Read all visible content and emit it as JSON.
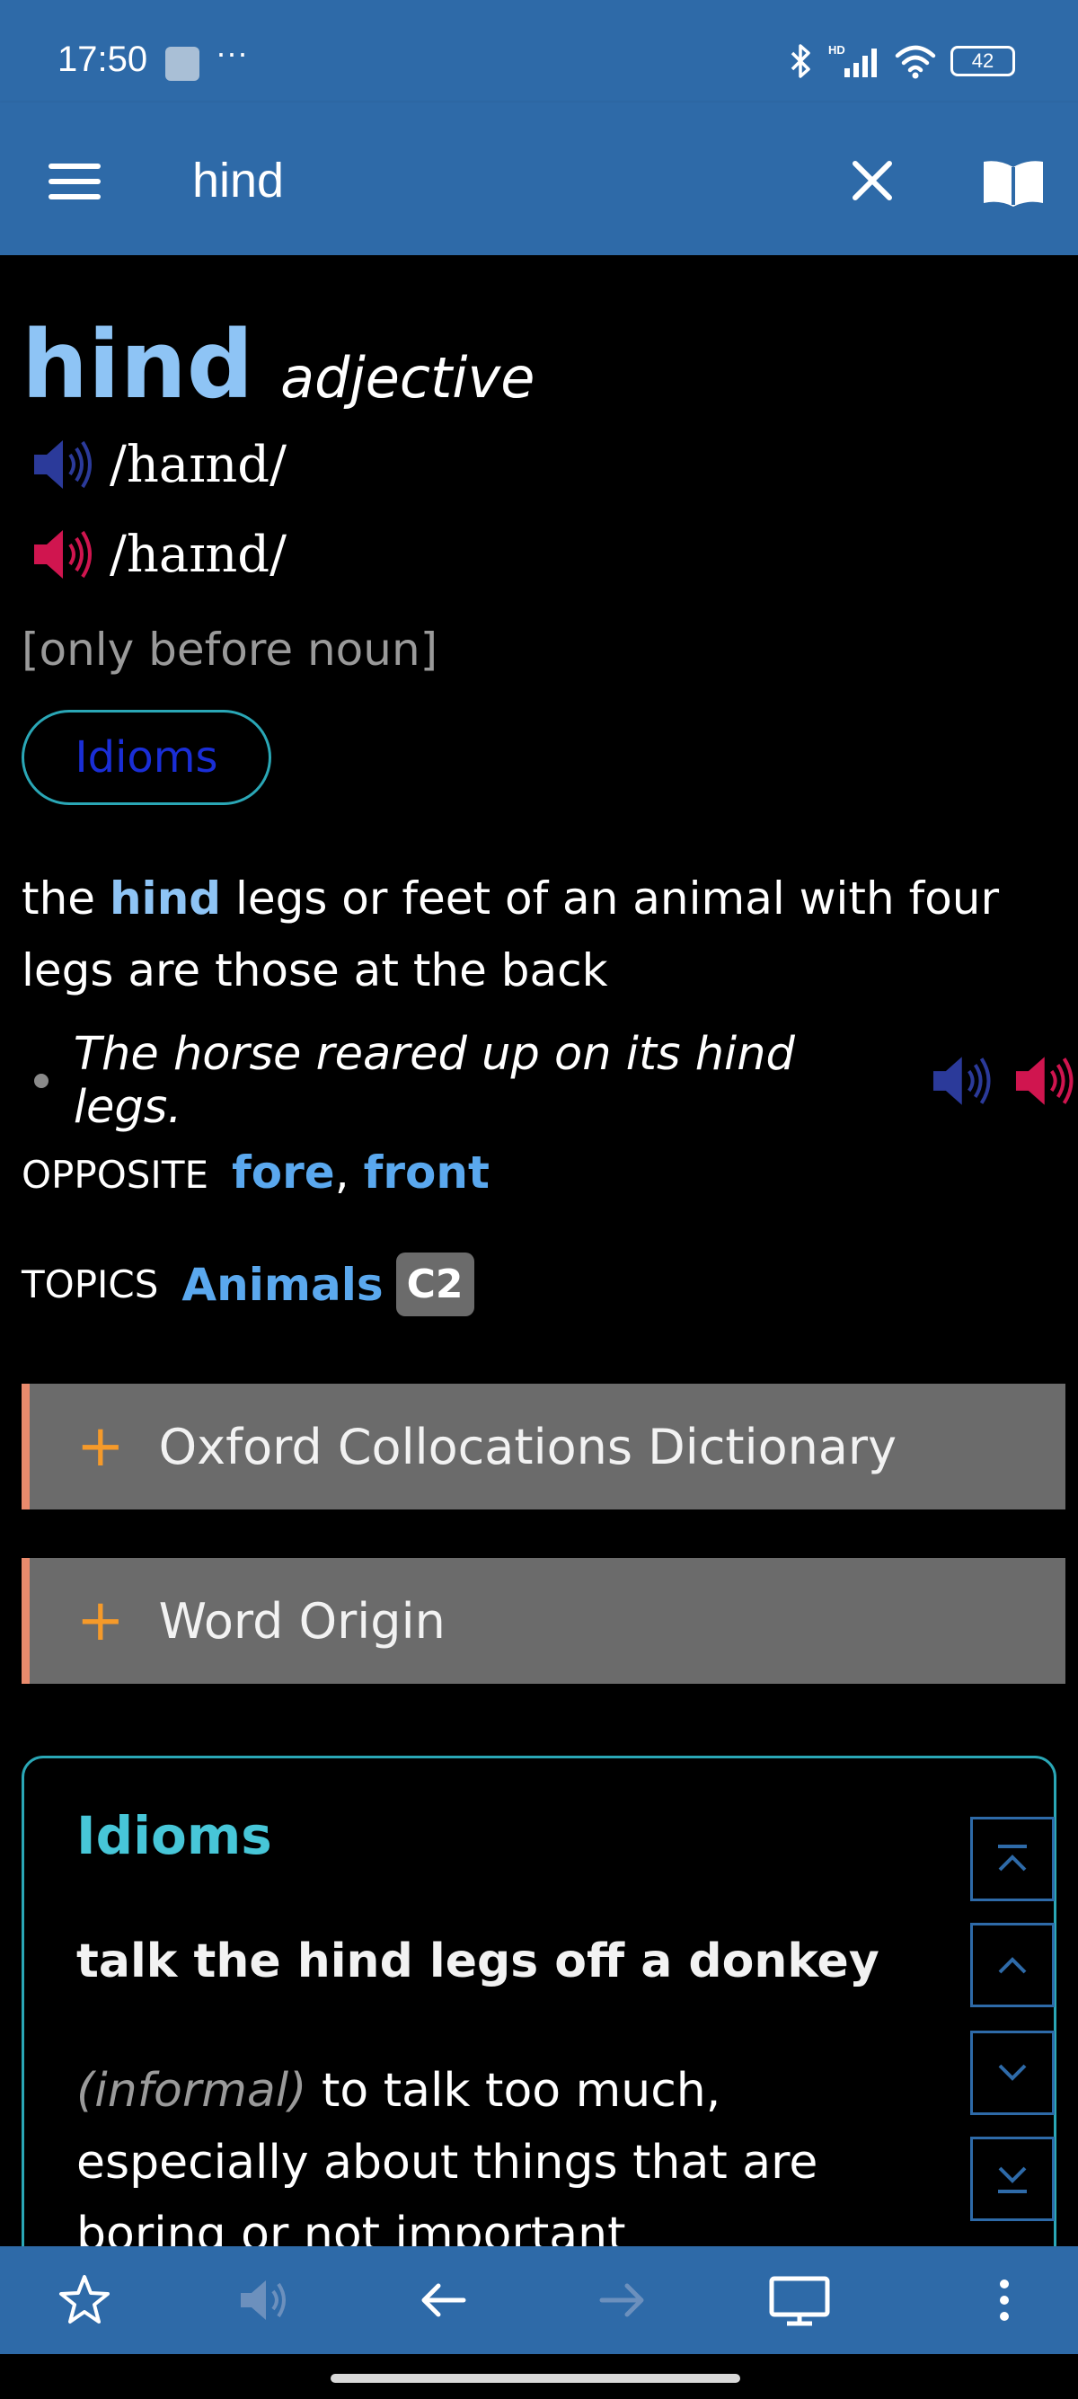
{
  "status_bar": {
    "time": "17:50",
    "more": "···",
    "signal_label": "HD",
    "battery": "42"
  },
  "app_bar": {
    "search_value": "hind",
    "menu_icon": "hamburger-icon",
    "clear_icon": "close-icon",
    "book_icon": "book-icon"
  },
  "entry": {
    "headword": "hind",
    "part_of_speech": "adjective",
    "pron_uk": "/haɪnd/",
    "pron_us": "/haɪnd/",
    "grammar": "[only before noun]",
    "idioms_button": "Idioms",
    "definition_before": "the ",
    "definition_highlight": "hind",
    "definition_after": " legs or feet of an animal with four legs are those at the back",
    "example": "The horse reared up on its hind legs.",
    "opposite_label": "OPPOSITE",
    "opposite_1": "fore",
    "opposite_sep": ",",
    "opposite_2": "front",
    "topics_label": "TOPICS",
    "topic": "Animals",
    "cefr_level": "C2"
  },
  "sections": {
    "collocations": "Oxford Collocations Dictionary",
    "word_origin": "Word Origin",
    "plus": "+"
  },
  "idioms_block": {
    "title": "Idioms",
    "phrase": "talk the hind legs off a donkey",
    "register": "(informal)",
    "definition": " to talk too much, especially about things that are boring or not important"
  },
  "colors": {
    "app_blue": "#2e6aa8",
    "headword": "#8ec4f5",
    "link": "#5aa8ee",
    "uk_speaker": "#2b3a9a",
    "us_speaker": "#d0154f",
    "idioms_teal": "#47c6d8",
    "plus_orange": "#f59a2a",
    "section_grey": "#6b6b6b"
  }
}
